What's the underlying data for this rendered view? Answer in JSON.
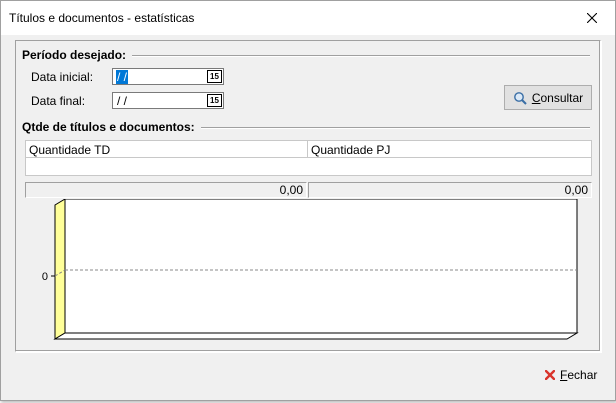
{
  "window": {
    "title": "Títulos e documentos - estatísticas"
  },
  "periodo": {
    "group_label": "Período desejado:",
    "data_inicial_label": "Data inicial:",
    "data_inicial_value": " /  /",
    "data_final_label": "Data final:",
    "data_final_value": " /  /",
    "calendar_icon_text": "15"
  },
  "consultar": {
    "pre": "",
    "mnemonic": "C",
    "post": "onsultar"
  },
  "qtde": {
    "group_label": "Qtde de títulos e documentos:",
    "columns": [
      "Quantidade TD",
      "Quantidade PJ"
    ],
    "totals": [
      "0,00",
      "0,00"
    ]
  },
  "chart_data": {
    "type": "bar",
    "categories": [],
    "series": [],
    "yticks": [
      "0"
    ],
    "grid": false,
    "style": "3d",
    "wall_color": "#ffff99"
  },
  "fechar": {
    "mnemonic": "F",
    "post": "echar"
  }
}
